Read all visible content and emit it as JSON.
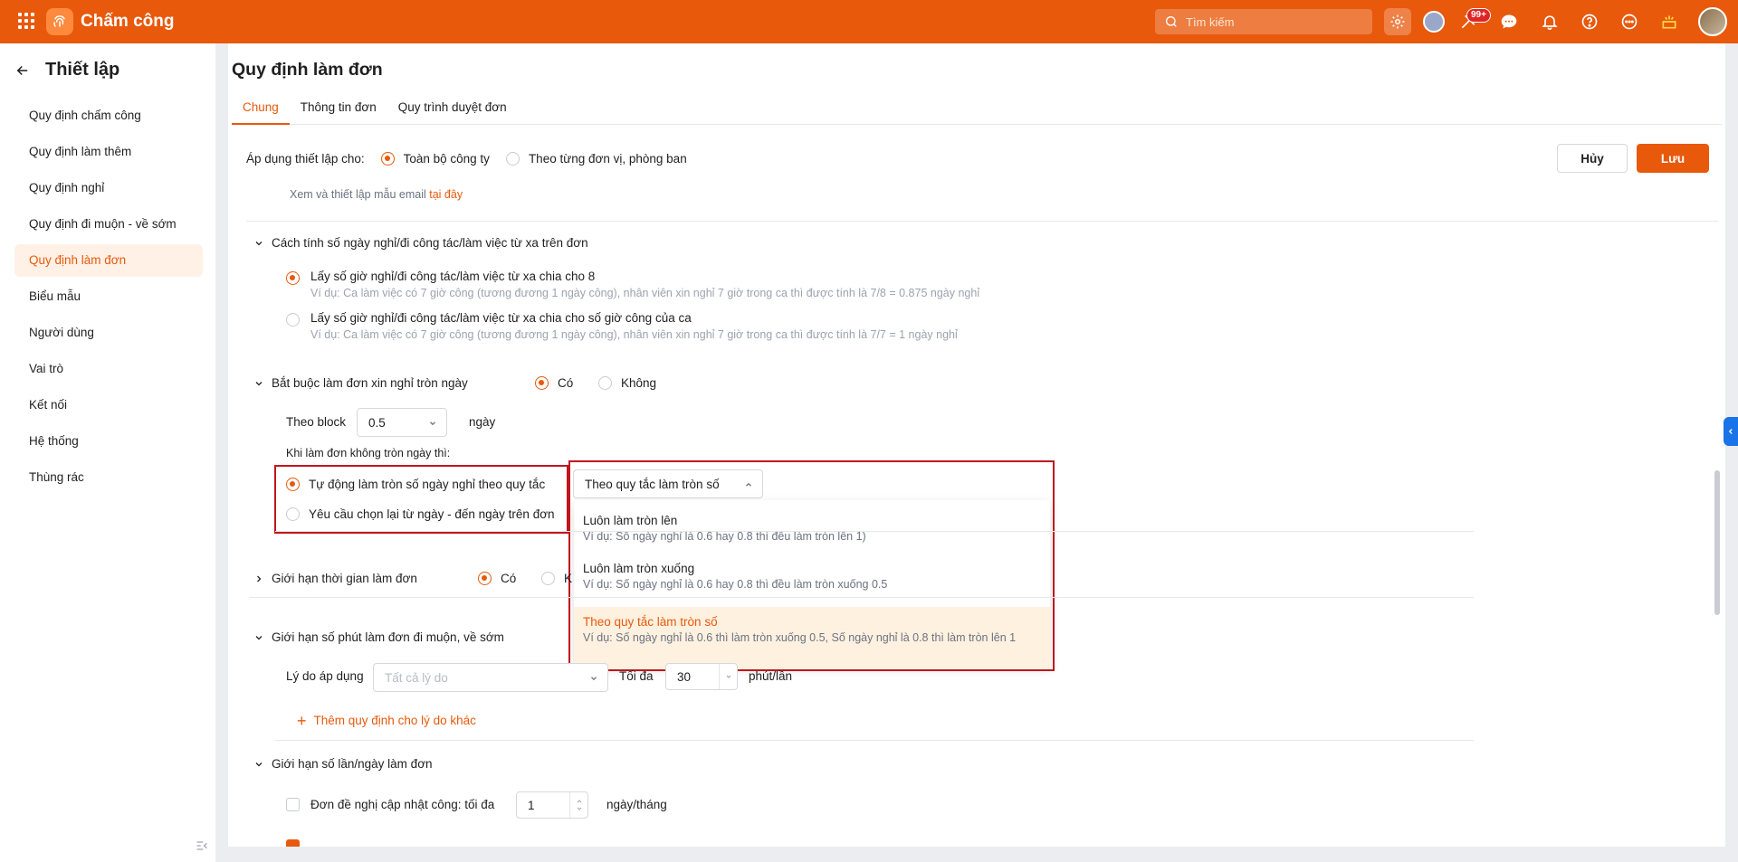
{
  "header": {
    "app_title": "Chấm công",
    "search_placeholder": "Tìm kiếm",
    "notification_badge": "99+"
  },
  "sidebar": {
    "title": "Thiết lập",
    "items": [
      {
        "label": "Quy định chấm công",
        "active": false
      },
      {
        "label": "Quy định làm thêm",
        "active": false
      },
      {
        "label": "Quy định nghỉ",
        "active": false
      },
      {
        "label": "Quy định đi muộn - về sớm",
        "active": false
      },
      {
        "label": "Quy định làm đơn",
        "active": true
      },
      {
        "label": "Biểu mẫu",
        "active": false
      },
      {
        "label": "Người dùng",
        "active": false
      },
      {
        "label": "Vai trò",
        "active": false
      },
      {
        "label": "Kết nối",
        "active": false
      },
      {
        "label": "Hệ thống",
        "active": false
      },
      {
        "label": "Thùng rác",
        "active": false
      }
    ]
  },
  "page": {
    "title": "Quy định làm đơn",
    "tabs": [
      {
        "label": "Chung",
        "active": true
      },
      {
        "label": "Thông tin đơn",
        "active": false
      },
      {
        "label": "Quy trình duyệt đơn",
        "active": false
      }
    ],
    "apply_label": "Áp dụng thiết lập cho:",
    "apply_options": [
      "Toàn bộ công ty",
      "Theo từng đơn vị, phòng ban"
    ],
    "cancel_label": "Hủy",
    "save_label": "Lưu",
    "email_text": "Xem và thiết lập mẫu email",
    "email_link": "tại đây"
  },
  "calc_section": {
    "title": "Cách tính số ngày nghỉ/đi công tác/làm việc từ xa trên đơn",
    "options": [
      {
        "label": "Lấy số giờ nghỉ/đi công tác/làm việc từ xa chia cho 8",
        "hint": "Ví dụ: Ca làm việc có 7 giờ công (tương đương 1 ngày công), nhân viên xin nghỉ 7 giờ trong ca thì được tính là 7/8 = 0.875 ngày nghỉ",
        "selected": true
      },
      {
        "label": "Lấy số giờ nghỉ/đi công tác/làm việc từ xa chia cho số giờ công của ca",
        "hint": "Ví dụ: Ca làm việc có 7 giờ công (tương đương 1 ngày công), nhân viên xin nghỉ 7 giờ trong ca thì được tính là 7/7 = 1 ngày nghỉ",
        "selected": false
      }
    ]
  },
  "fullday_section": {
    "title": "Bắt buộc làm đơn xin nghỉ tròn ngày",
    "yes": "Có",
    "no": "Không",
    "block_label": "Theo block",
    "block_value": "0.5",
    "block_unit": "ngày",
    "when_label": "Khi làm đơn không tròn ngày thì:",
    "auto_round": "Tự động làm tròn số ngày nghỉ theo quy tắc",
    "reselect": "Yêu cầu chọn lại từ ngày - đến ngày trên đơn",
    "rule_select": "Theo quy tắc làm tròn số",
    "dropdown": [
      {
        "label": "Luôn làm tròn lên",
        "hint": "Ví dụ: Số ngày nghỉ là 0.6 hay 0.8 thì đều làm tròn lên 1)",
        "selected": false
      },
      {
        "label": "Luôn làm tròn xuống",
        "hint": "Ví dụ: Số ngày nghỉ là 0.6 hay 0.8 thì đều làm tròn xuống 0.5",
        "selected": false
      },
      {
        "label": "Theo quy tắc làm tròn số",
        "hint": "Ví dụ: Số ngày nghỉ là 0.6 thì làm tròn xuống 0.5, Số ngày nghỉ là 0.8 thì làm tròn lên 1",
        "selected": true
      }
    ]
  },
  "time_limit_section": {
    "title": "Giới hạn thời gian làm đơn",
    "yes": "Có",
    "no_partial": "K"
  },
  "minutes_section": {
    "title": "Giới hạn số phút làm đơn đi muộn, về sớm",
    "reason_label": "Lý do áp dụng",
    "reason_placeholder": "Tất cả lý do",
    "max_label": "Tối đa",
    "max_value": "30",
    "max_unit": "phút/lần",
    "add_rule": "Thêm quy định cho lý do khác"
  },
  "count_section": {
    "title": "Giới hạn số lần/ngày làm đơn",
    "update_label": "Đơn đề nghị cập nhật công: tối đa",
    "update_value": "1",
    "update_unit": "ngày/tháng"
  }
}
